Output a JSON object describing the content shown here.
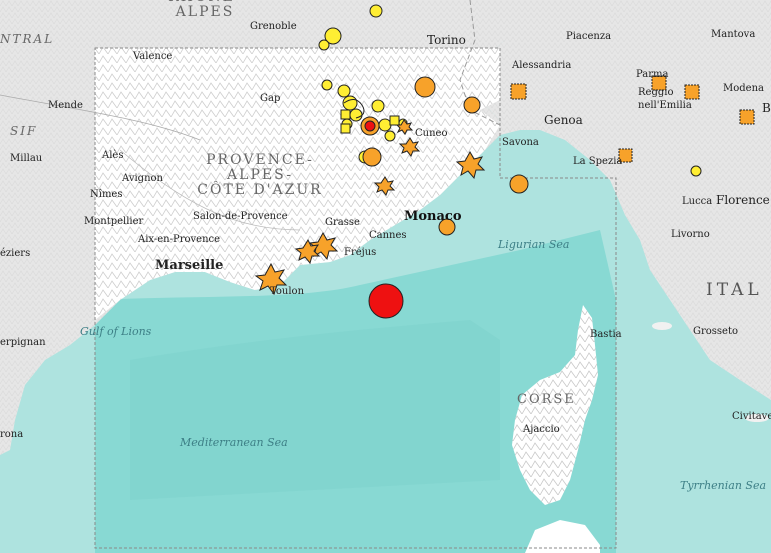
{
  "map": {
    "colors": {
      "sea": "#aee3df",
      "deep_sea": "#7ed6d1",
      "land": "#e6e6e6",
      "highlight_land": "#ffffff",
      "mountain": "#cfcfcf",
      "quake_yellow": "#ffee33",
      "quake_orange": "#f7a22a",
      "quake_red": "#ee1111",
      "outline": "#222222"
    },
    "labels": {
      "rhone_alpes": "RHÔNE-\nALPES",
      "central": "NTRAL",
      "massif": "SIF",
      "provence": "PROVENCE-\nALPES-\nCÔTE D'AZUR",
      "italia": "ITAL",
      "corse": "CORSE",
      "grenoble": "Grenoble",
      "torino": "Torino",
      "piacenza": "Piacenza",
      "mantova": "Mantova",
      "valence": "Valence",
      "alessandria": "Alessandria",
      "parma": "Parma",
      "modena": "Modena",
      "reggio": "Reggio\nnell'Emilia",
      "b": "B",
      "mende": "Mende",
      "gap": "Gap",
      "genoa": "Genoa",
      "cuneo": "Cuneo",
      "millau": "Millau",
      "ales": "Alès",
      "avignon": "Avignon",
      "savona": "Savona",
      "la_spezia": "La Spezia",
      "nimes": "Nîmes",
      "montpellier": "Montpellier",
      "salon": "Salon-de-Provence",
      "lucca": "Lucca",
      "florence": "Florence",
      "monaco": "Monaco",
      "grasse": "Grasse",
      "cannes": "Cannes",
      "aix": "Aix-en-Provence",
      "frejus": "Fréjus",
      "livorno": "Livorno",
      "beziers": "éziers",
      "marseille": "Marseille",
      "toulon": "Toulon",
      "bastia": "Bastia",
      "grosseto": "Grosseto",
      "perpignan": "erpignan",
      "ajaccio": "Ajaccio",
      "civitavecchia": "Civitave",
      "rona": "rona",
      "ligurian_sea": "Ligurian Sea",
      "gulf_of_lions": "Gulf of Lions",
      "mediterranean_sea": "Mediterranean Sea",
      "tyrrhenian_sea": "Tyrrhenian Sea"
    },
    "legend_none": ""
  }
}
